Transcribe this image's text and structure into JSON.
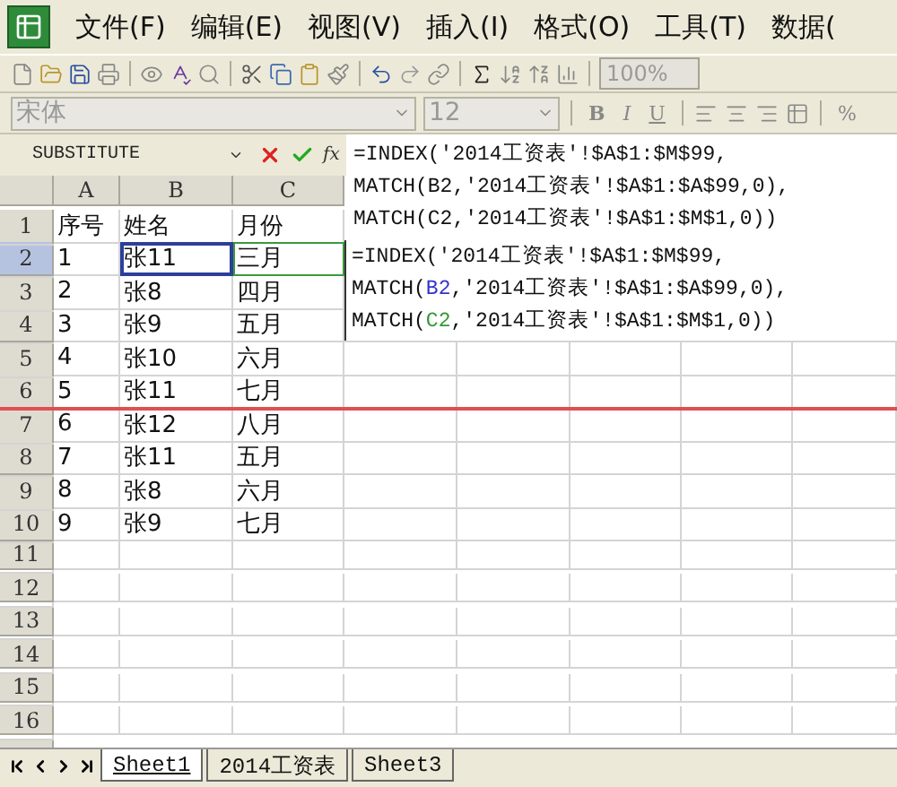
{
  "menu": [
    "文件(F)",
    "编辑(E)",
    "视图(V)",
    "插入(I)",
    "格式(O)",
    "工具(T)",
    "数据("
  ],
  "toolbar": {
    "zoom": "100%"
  },
  "format_bar": {
    "font": "宋体",
    "size": "12",
    "bold": "B",
    "italic": "I",
    "underline": "U",
    "percent": "%"
  },
  "formula_bar": {
    "name_box": "SUBSTITUTE",
    "function_button": "fx",
    "lines": [
      [
        {
          "text": "=INDEX('2014工资表'!$A$1:$M$99,"
        }
      ],
      [
        {
          "text": "MATCH(B2,'2014工资表'!$A$1:$A$99,0),"
        }
      ],
      [
        {
          "text": "MATCH(C2,'2014工资表'!$A$1:$M$1,0))"
        }
      ]
    ]
  },
  "columns": [
    "A",
    "B",
    "C"
  ],
  "rows": [
    {
      "header": "1",
      "selected": false,
      "cells": [
        "序号",
        "姓名",
        "月份"
      ]
    },
    {
      "header": "2",
      "selected": true,
      "cells": [
        "1",
        "张11",
        "三月"
      ]
    },
    {
      "header": "3",
      "selected": false,
      "cells": [
        "2",
        "张8",
        "四月"
      ]
    },
    {
      "header": "4",
      "selected": false,
      "cells": [
        "3",
        "张9",
        "五月"
      ]
    },
    {
      "header": "5",
      "selected": false,
      "cells": [
        "4",
        "张10",
        "六月"
      ]
    },
    {
      "header": "6",
      "selected": false,
      "cells": [
        "5",
        "张11",
        "七月"
      ]
    },
    {
      "header": "7",
      "selected": false,
      "cells": [
        "6",
        "张12",
        "八月"
      ]
    },
    {
      "header": "8",
      "selected": false,
      "cells": [
        "7",
        "张11",
        "五月"
      ]
    },
    {
      "header": "9",
      "selected": false,
      "cells": [
        "8",
        "张8",
        "六月"
      ]
    },
    {
      "header": "10",
      "selected": false,
      "cells": [
        "9",
        "张9",
        "七月"
      ]
    },
    {
      "header": "11",
      "selected": false,
      "cells": []
    },
    {
      "header": "12",
      "selected": false,
      "cells": []
    },
    {
      "header": "13",
      "selected": false,
      "cells": []
    },
    {
      "header": "14",
      "selected": false,
      "cells": []
    },
    {
      "header": "15",
      "selected": false,
      "cells": []
    },
    {
      "header": "16",
      "selected": false,
      "cells": []
    }
  ],
  "cell_editor": {
    "lines": [
      [
        {
          "text": "=INDEX('2014工资表'!$A$1:$M$99,"
        }
      ],
      [
        {
          "text": "MATCH("
        },
        {
          "text": "B2",
          "color": "#3333cc"
        },
        {
          "text": ",'2014工资表'!$A$1:$A$99,0),"
        }
      ],
      [
        {
          "text": "MATCH("
        },
        {
          "text": "C2",
          "color": "#339933"
        },
        {
          "text": ",'2014工资表'!$A$1:$M$1,0))"
        }
      ]
    ]
  },
  "sheet_tabs": [
    {
      "label": "Sheet1",
      "selected": true
    },
    {
      "label": "2014工资表",
      "selected": false
    },
    {
      "label": "Sheet3",
      "selected": false
    }
  ]
}
